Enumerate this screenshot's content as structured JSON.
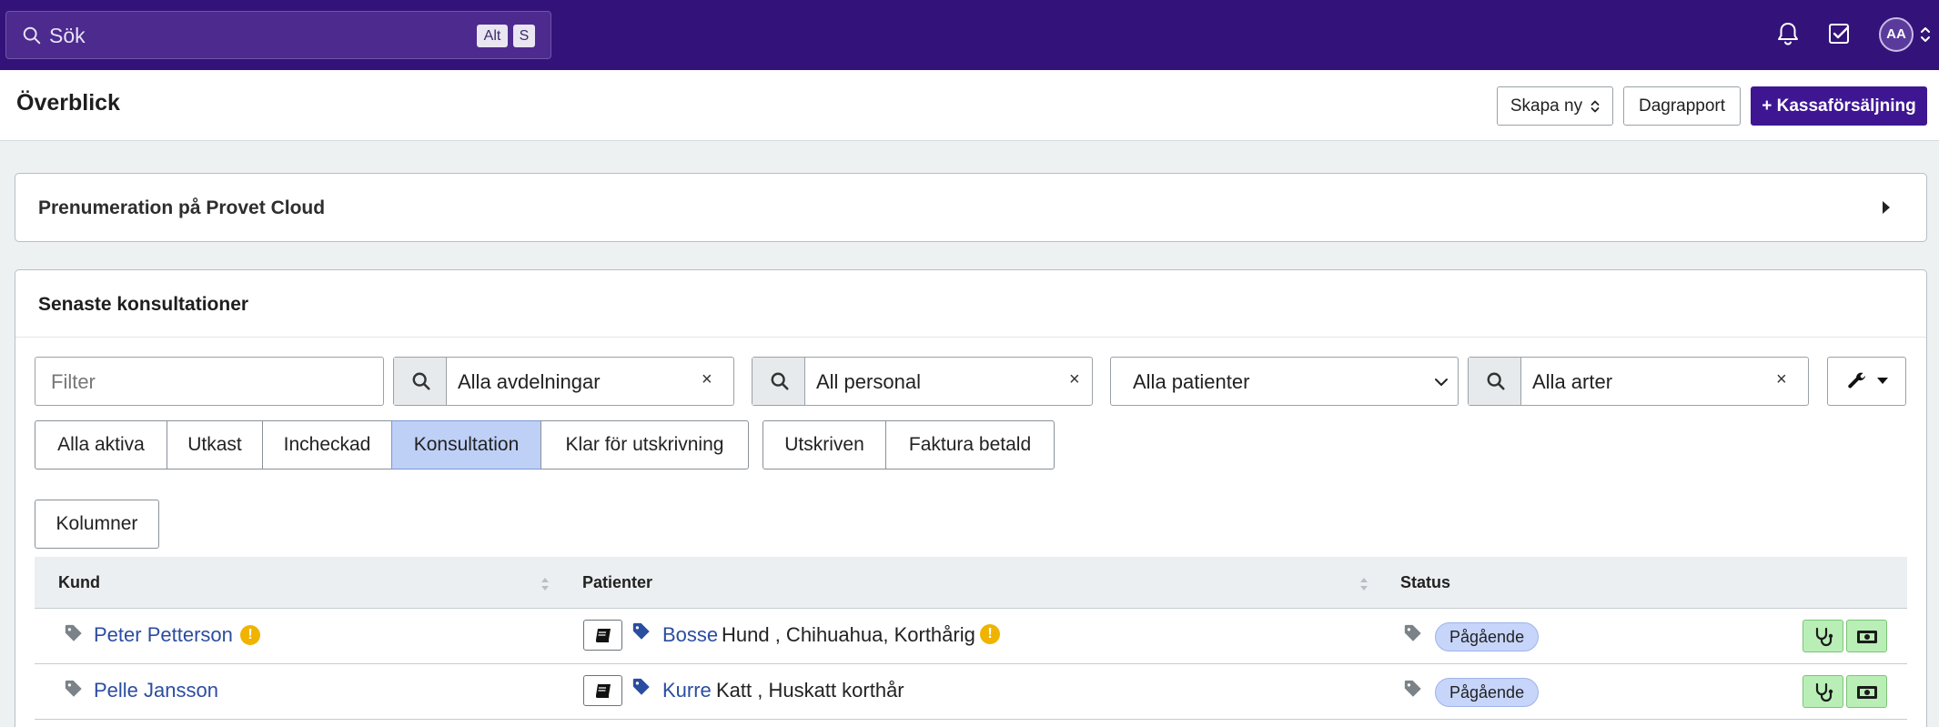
{
  "topbar": {
    "search_placeholder": "Sök",
    "shortcut_keys": [
      "Alt",
      "S"
    ],
    "user_initials": "AA",
    "icons": [
      "search-icon",
      "bell-icon",
      "task-check-icon",
      "chevron-updown-icon"
    ]
  },
  "header": {
    "title": "Överblick",
    "create_new_label": "Skapa ny",
    "day_report_label": "Dagrapport",
    "cash_sale_label": "+ Kassaförsäljning"
  },
  "subscription_card": {
    "title": "Prenumeration på Provet Cloud"
  },
  "consultations": {
    "title": "Senaste konsultationer",
    "filter_placeholder": "Filter",
    "department_filter": "Alla avdelningar",
    "staff_filter": "All personal",
    "patient_select": "Alla patienter",
    "species_filter": "Alla arter",
    "clear_symbol": "×",
    "status_tabs_group1": [
      "Alla aktiva",
      "Utkast",
      "Incheckad",
      "Konsultation",
      "Klar för utskrivning"
    ],
    "status_tabs_group2": [
      "Utskriven",
      "Faktura betald"
    ],
    "active_tab": "Konsultation",
    "columns_button": "Kolumner",
    "table": {
      "headers": [
        "Kund",
        "Patienter",
        "Status"
      ],
      "rows": [
        {
          "customer": "Peter Petterson",
          "customer_warning": true,
          "patient_name": "Bosse",
          "patient_details": "Hund , Chihuahua, Korthårig",
          "patient_warning": true,
          "status": "Pågående"
        },
        {
          "customer": "Pelle Jansson",
          "customer_warning": false,
          "patient_name": "Kurre",
          "patient_details": "Katt , Huskatt korthår",
          "patient_warning": false,
          "status": "Pågående"
        }
      ]
    }
  },
  "colors": {
    "topbar_bg": "#33127a",
    "primary_button": "#3f1692",
    "link": "#2b4da0",
    "active_tab": "#bfd0f7",
    "status_badge": "#c7d5fb",
    "action_button": "#b9efb6",
    "warning": "#f0b400"
  }
}
